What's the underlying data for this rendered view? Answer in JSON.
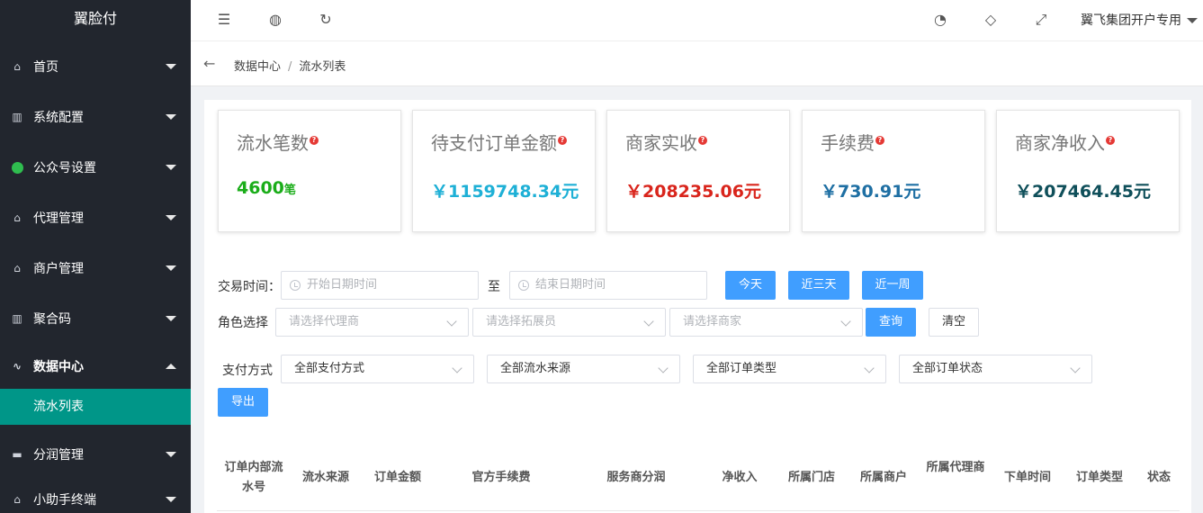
{
  "sidebar": {
    "brand": "翼脸付",
    "items": [
      {
        "label": "首页",
        "icon": "home-icon"
      },
      {
        "label": "系统配置",
        "icon": "book-icon"
      },
      {
        "label": "公众号设置",
        "icon": "wechat-icon"
      },
      {
        "label": "代理管理",
        "icon": "home-icon"
      },
      {
        "label": "商户管理",
        "icon": "home-icon"
      },
      {
        "label": "聚合码",
        "icon": "book-icon"
      },
      {
        "label": "数据中心",
        "icon": "pulse-icon"
      },
      {
        "label": "分润管理",
        "icon": "chat-icon"
      },
      {
        "label": "小助手终端",
        "icon": "home-icon"
      }
    ],
    "active_sub": "流水列表"
  },
  "topbar": {
    "icons": [
      "indent-icon",
      "globe-icon",
      "refresh-icon",
      "palette-icon",
      "tag-icon",
      "fullscreen-icon"
    ],
    "user": "翼飞集团开户专用"
  },
  "breadcrumb": {
    "items": [
      "数据中心",
      "流水列表"
    ],
    "separator": "/"
  },
  "stats": [
    {
      "title": "流水笔数",
      "value": "4600",
      "unit": "笔",
      "color": "#1aad19"
    },
    {
      "title": "待支付订单金额",
      "value": "￥1159748.34元",
      "unit": "",
      "color": "#1eb0d6"
    },
    {
      "title": "商家实收",
      "value": "￥208235.06元",
      "unit": "",
      "color": "#d9251c"
    },
    {
      "title": "手续费",
      "value": "￥730.91元",
      "unit": "",
      "color": "#1e6fa3"
    },
    {
      "title": "商家净收入",
      "value": "￥207464.45元",
      "unit": "",
      "color": "#0f4f5a"
    }
  ],
  "filters": {
    "time_label": "交易时间：",
    "start_placeholder": "开始日期时间",
    "to_label": "至",
    "end_placeholder": "结束日期时间",
    "btn_today": "今天",
    "btn_3days": "近三天",
    "btn_week": "近一周",
    "role_label": "角色选择",
    "agent_placeholder": "请选择代理商",
    "promoter_placeholder": "请选择拓展员",
    "merchant_placeholder": "请选择商家",
    "btn_query": "查询",
    "btn_clear": "清空",
    "pay_label": "支付方式",
    "pay_value": "全部支付方式",
    "source_value": "全部流水来源",
    "type_value": "全部订单类型",
    "status_value": "全部订单状态",
    "btn_export": "导出"
  },
  "table": {
    "headers": [
      "订单内部流水号",
      "流水来源",
      "订单金额",
      "官方手续费",
      "服务商分润",
      "净收入",
      "所属门店",
      "所属商户",
      "所属代理商",
      "下单时间",
      "订单类型",
      "状态"
    ]
  }
}
